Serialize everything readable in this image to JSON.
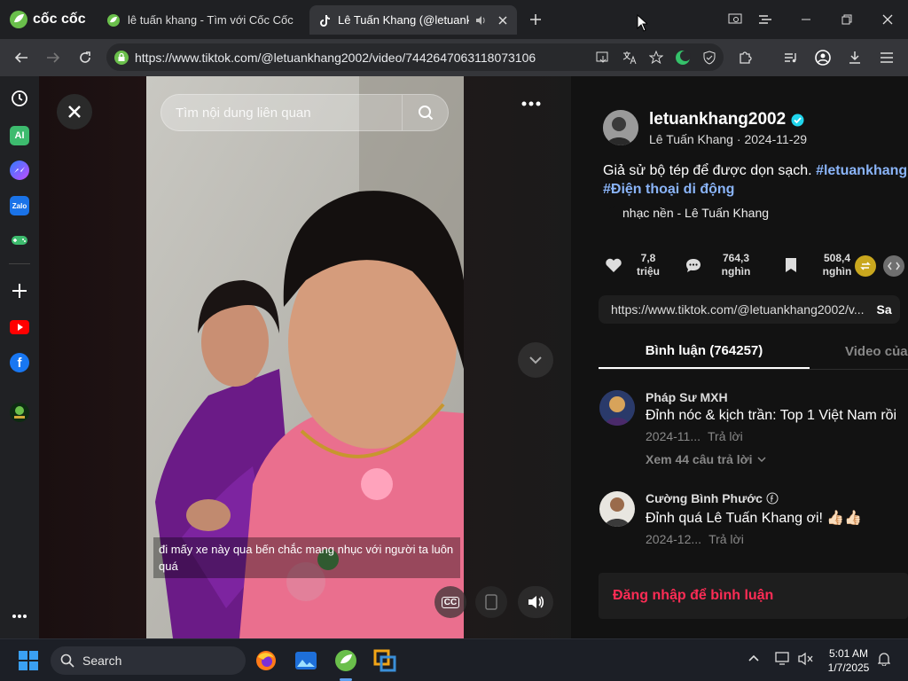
{
  "browser": {
    "brand": "cốc cốc",
    "tabs": [
      {
        "label": "lê tuấn khang - Tìm với Cốc Cốc"
      },
      {
        "label": "Lê Tuấn Khang (@letuankh"
      }
    ],
    "url": "https://www.tiktok.com/@letuankhang2002/video/7442647063118073106"
  },
  "video": {
    "search_placeholder": "Tìm nội dung liên quan",
    "caption": "đi mấy xe này qua bến chắc mang nhục với người ta luôn quá",
    "cc_label": "CC"
  },
  "post": {
    "username": "letuankhang2002",
    "display_name": "Lê Tuấn Khang",
    "date": "2024-11-29",
    "description": "Giả sử bộ tép để được dọn sạch.",
    "hashtag1": "#letuankhang",
    "hashtag2": "#Điện thoại di động",
    "music": "nhạc nền - Lê Tuấn Khang",
    "likes_value": "7,8",
    "likes_unit": "triệu",
    "comments_value": "764,3",
    "comments_unit": "nghìn",
    "saves_value": "508,4",
    "saves_unit": "nghìn",
    "link": "https://www.tiktok.com/@letuankhang2002/v...",
    "link_action": "Sa",
    "tab_comments": "Bình luận (764257)",
    "tab_videos": "Video của n"
  },
  "comments": [
    {
      "author": "Pháp Sư MXH",
      "text": "Đỉnh nóc & kịch trần: Top 1 Việt Nam rồi",
      "date": "2024-11...",
      "reply": "Trả lời",
      "more": "Xem 44 câu trả lời"
    },
    {
      "author": "Cường Bình Phước",
      "text": "Đỉnh quá Lê Tuấn Khang ơi! 👍🏻👍🏻",
      "date": "2024-12...",
      "reply": "Trả lời"
    }
  ],
  "login_prompt": "Đăng nhập để bình luận",
  "taskbar": {
    "search": "Search",
    "time": "5:01 AM",
    "date": "1/7/2025"
  },
  "colors": {
    "accent_red": "#fe2c55",
    "hashtag_blue": "#8ab4f8",
    "verified": "#20d5ec",
    "coccoc_green": "#5cb85c"
  }
}
